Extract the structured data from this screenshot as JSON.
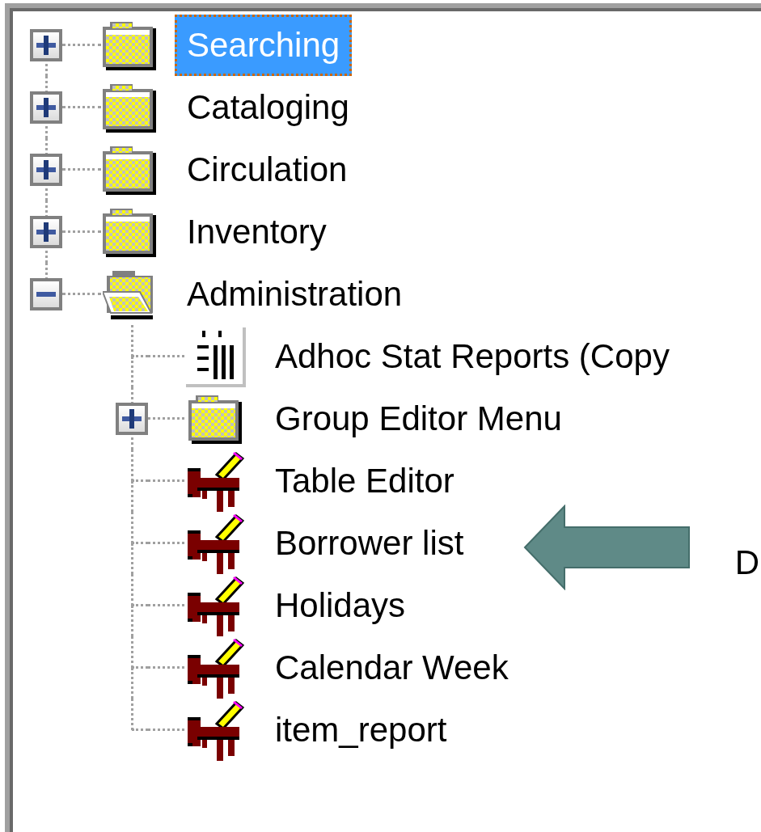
{
  "tree": [
    {
      "label": "Searching",
      "kind": "folder",
      "expanded": false,
      "selected": true
    },
    {
      "label": "Cataloging",
      "kind": "folder",
      "expanded": false,
      "selected": false
    },
    {
      "label": "Circulation",
      "kind": "folder",
      "expanded": false,
      "selected": false
    },
    {
      "label": "Inventory",
      "kind": "folder",
      "expanded": false,
      "selected": false
    },
    {
      "label": "Administration",
      "kind": "folder",
      "expanded": true,
      "selected": false,
      "children": [
        {
          "label": "Adhoc Stat Reports (Copy",
          "kind": "report",
          "selected": false
        },
        {
          "label": "Group Editor Menu",
          "kind": "folder",
          "expanded": false,
          "selected": false
        },
        {
          "label": "Table Editor",
          "kind": "editor",
          "selected": false
        },
        {
          "label": "Borrower list",
          "kind": "editor",
          "selected": false
        },
        {
          "label": "Holidays",
          "kind": "editor",
          "selected": false
        },
        {
          "label": "Calendar Week",
          "kind": "editor",
          "selected": false
        },
        {
          "label": "item_report",
          "kind": "editor",
          "selected": false
        }
      ]
    }
  ],
  "callout": {
    "label": "D"
  }
}
